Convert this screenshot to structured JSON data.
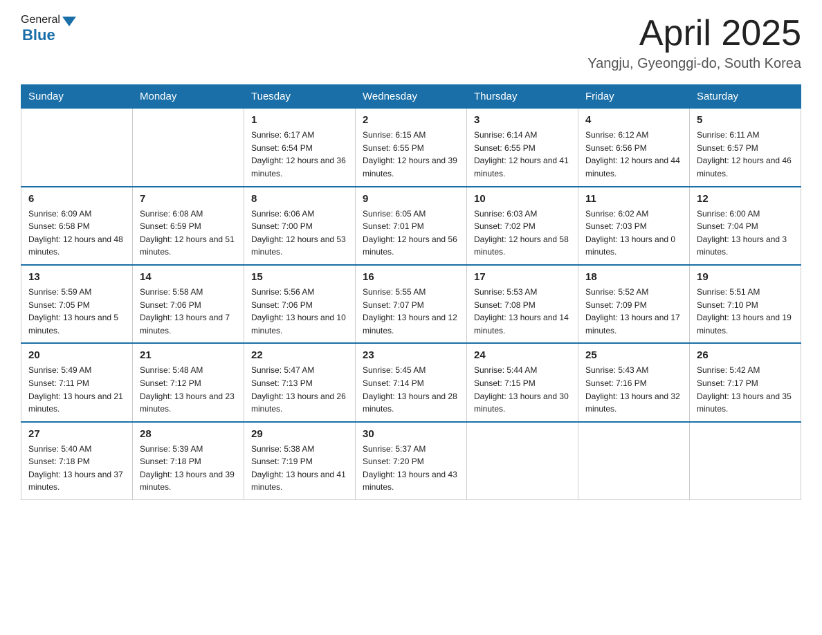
{
  "header": {
    "logo_general": "General",
    "logo_blue": "Blue",
    "title": "April 2025",
    "location": "Yangju, Gyeonggi-do, South Korea"
  },
  "weekdays": [
    "Sunday",
    "Monday",
    "Tuesday",
    "Wednesday",
    "Thursday",
    "Friday",
    "Saturday"
  ],
  "weeks": [
    [
      {
        "day": "",
        "sunrise": "",
        "sunset": "",
        "daylight": ""
      },
      {
        "day": "",
        "sunrise": "",
        "sunset": "",
        "daylight": ""
      },
      {
        "day": "1",
        "sunrise": "Sunrise: 6:17 AM",
        "sunset": "Sunset: 6:54 PM",
        "daylight": "Daylight: 12 hours and 36 minutes."
      },
      {
        "day": "2",
        "sunrise": "Sunrise: 6:15 AM",
        "sunset": "Sunset: 6:55 PM",
        "daylight": "Daylight: 12 hours and 39 minutes."
      },
      {
        "day": "3",
        "sunrise": "Sunrise: 6:14 AM",
        "sunset": "Sunset: 6:55 PM",
        "daylight": "Daylight: 12 hours and 41 minutes."
      },
      {
        "day": "4",
        "sunrise": "Sunrise: 6:12 AM",
        "sunset": "Sunset: 6:56 PM",
        "daylight": "Daylight: 12 hours and 44 minutes."
      },
      {
        "day": "5",
        "sunrise": "Sunrise: 6:11 AM",
        "sunset": "Sunset: 6:57 PM",
        "daylight": "Daylight: 12 hours and 46 minutes."
      }
    ],
    [
      {
        "day": "6",
        "sunrise": "Sunrise: 6:09 AM",
        "sunset": "Sunset: 6:58 PM",
        "daylight": "Daylight: 12 hours and 48 minutes."
      },
      {
        "day": "7",
        "sunrise": "Sunrise: 6:08 AM",
        "sunset": "Sunset: 6:59 PM",
        "daylight": "Daylight: 12 hours and 51 minutes."
      },
      {
        "day": "8",
        "sunrise": "Sunrise: 6:06 AM",
        "sunset": "Sunset: 7:00 PM",
        "daylight": "Daylight: 12 hours and 53 minutes."
      },
      {
        "day": "9",
        "sunrise": "Sunrise: 6:05 AM",
        "sunset": "Sunset: 7:01 PM",
        "daylight": "Daylight: 12 hours and 56 minutes."
      },
      {
        "day": "10",
        "sunrise": "Sunrise: 6:03 AM",
        "sunset": "Sunset: 7:02 PM",
        "daylight": "Daylight: 12 hours and 58 minutes."
      },
      {
        "day": "11",
        "sunrise": "Sunrise: 6:02 AM",
        "sunset": "Sunset: 7:03 PM",
        "daylight": "Daylight: 13 hours and 0 minutes."
      },
      {
        "day": "12",
        "sunrise": "Sunrise: 6:00 AM",
        "sunset": "Sunset: 7:04 PM",
        "daylight": "Daylight: 13 hours and 3 minutes."
      }
    ],
    [
      {
        "day": "13",
        "sunrise": "Sunrise: 5:59 AM",
        "sunset": "Sunset: 7:05 PM",
        "daylight": "Daylight: 13 hours and 5 minutes."
      },
      {
        "day": "14",
        "sunrise": "Sunrise: 5:58 AM",
        "sunset": "Sunset: 7:06 PM",
        "daylight": "Daylight: 13 hours and 7 minutes."
      },
      {
        "day": "15",
        "sunrise": "Sunrise: 5:56 AM",
        "sunset": "Sunset: 7:06 PM",
        "daylight": "Daylight: 13 hours and 10 minutes."
      },
      {
        "day": "16",
        "sunrise": "Sunrise: 5:55 AM",
        "sunset": "Sunset: 7:07 PM",
        "daylight": "Daylight: 13 hours and 12 minutes."
      },
      {
        "day": "17",
        "sunrise": "Sunrise: 5:53 AM",
        "sunset": "Sunset: 7:08 PM",
        "daylight": "Daylight: 13 hours and 14 minutes."
      },
      {
        "day": "18",
        "sunrise": "Sunrise: 5:52 AM",
        "sunset": "Sunset: 7:09 PM",
        "daylight": "Daylight: 13 hours and 17 minutes."
      },
      {
        "day": "19",
        "sunrise": "Sunrise: 5:51 AM",
        "sunset": "Sunset: 7:10 PM",
        "daylight": "Daylight: 13 hours and 19 minutes."
      }
    ],
    [
      {
        "day": "20",
        "sunrise": "Sunrise: 5:49 AM",
        "sunset": "Sunset: 7:11 PM",
        "daylight": "Daylight: 13 hours and 21 minutes."
      },
      {
        "day": "21",
        "sunrise": "Sunrise: 5:48 AM",
        "sunset": "Sunset: 7:12 PM",
        "daylight": "Daylight: 13 hours and 23 minutes."
      },
      {
        "day": "22",
        "sunrise": "Sunrise: 5:47 AM",
        "sunset": "Sunset: 7:13 PM",
        "daylight": "Daylight: 13 hours and 26 minutes."
      },
      {
        "day": "23",
        "sunrise": "Sunrise: 5:45 AM",
        "sunset": "Sunset: 7:14 PM",
        "daylight": "Daylight: 13 hours and 28 minutes."
      },
      {
        "day": "24",
        "sunrise": "Sunrise: 5:44 AM",
        "sunset": "Sunset: 7:15 PM",
        "daylight": "Daylight: 13 hours and 30 minutes."
      },
      {
        "day": "25",
        "sunrise": "Sunrise: 5:43 AM",
        "sunset": "Sunset: 7:16 PM",
        "daylight": "Daylight: 13 hours and 32 minutes."
      },
      {
        "day": "26",
        "sunrise": "Sunrise: 5:42 AM",
        "sunset": "Sunset: 7:17 PM",
        "daylight": "Daylight: 13 hours and 35 minutes."
      }
    ],
    [
      {
        "day": "27",
        "sunrise": "Sunrise: 5:40 AM",
        "sunset": "Sunset: 7:18 PM",
        "daylight": "Daylight: 13 hours and 37 minutes."
      },
      {
        "day": "28",
        "sunrise": "Sunrise: 5:39 AM",
        "sunset": "Sunset: 7:18 PM",
        "daylight": "Daylight: 13 hours and 39 minutes."
      },
      {
        "day": "29",
        "sunrise": "Sunrise: 5:38 AM",
        "sunset": "Sunset: 7:19 PM",
        "daylight": "Daylight: 13 hours and 41 minutes."
      },
      {
        "day": "30",
        "sunrise": "Sunrise: 5:37 AM",
        "sunset": "Sunset: 7:20 PM",
        "daylight": "Daylight: 13 hours and 43 minutes."
      },
      {
        "day": "",
        "sunrise": "",
        "sunset": "",
        "daylight": ""
      },
      {
        "day": "",
        "sunrise": "",
        "sunset": "",
        "daylight": ""
      },
      {
        "day": "",
        "sunrise": "",
        "sunset": "",
        "daylight": ""
      }
    ]
  ],
  "colors": {
    "header_bg": "#1a6fa8",
    "header_text": "#ffffff",
    "border": "#1a6fa8",
    "cell_border": "#cccccc"
  }
}
